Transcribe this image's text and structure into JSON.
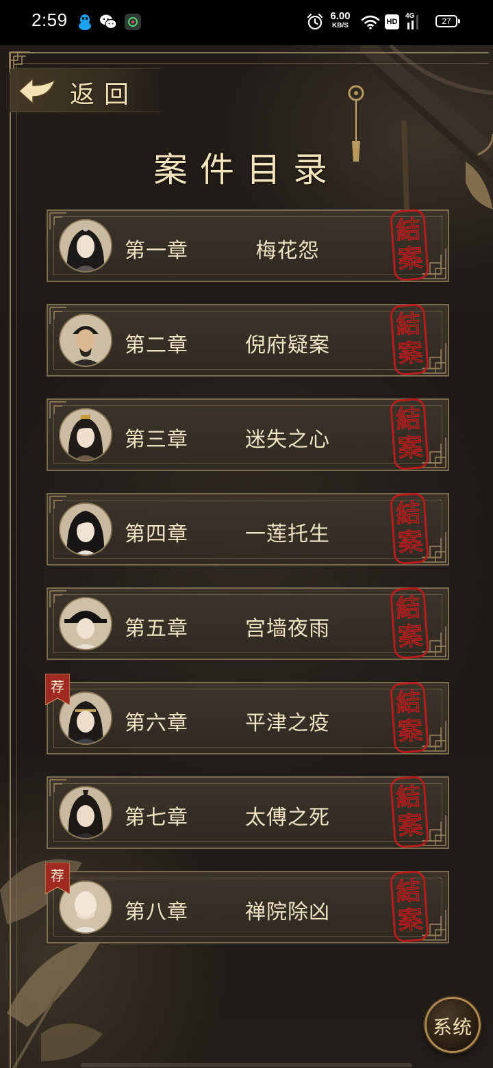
{
  "status_bar": {
    "time": "2:59",
    "net_speed_value": "6.00",
    "net_speed_unit": "KB/S",
    "hd_label": "HD",
    "signal_label": "4G",
    "battery": "27",
    "left_icons": [
      "qq-icon",
      "wechat-icon",
      "app-icon"
    ],
    "right_icons": [
      "alarm-icon",
      "wifi-icon",
      "hd-icon",
      "signal-4g-icon",
      "battery-icon"
    ]
  },
  "back": {
    "label": "返回"
  },
  "title": "案件目录",
  "chapters": [
    {
      "number": "第一章",
      "title": "梅花怨",
      "seal": "結案",
      "recommended": false,
      "avatar": "character-1"
    },
    {
      "number": "第二章",
      "title": "倪府疑案",
      "seal": "結案",
      "recommended": false,
      "avatar": "character-2"
    },
    {
      "number": "第三章",
      "title": "迷失之心",
      "seal": "結案",
      "recommended": false,
      "avatar": "character-3"
    },
    {
      "number": "第四章",
      "title": "一莲托生",
      "seal": "結案",
      "recommended": false,
      "avatar": "character-4"
    },
    {
      "number": "第五章",
      "title": "宫墙夜雨",
      "seal": "結案",
      "recommended": false,
      "avatar": "character-5"
    },
    {
      "number": "第六章",
      "title": "平津之疫",
      "seal": "結案",
      "recommended": true,
      "tag": "荐",
      "avatar": "character-6"
    },
    {
      "number": "第七章",
      "title": "太傅之死",
      "seal": "結案",
      "recommended": false,
      "avatar": "character-7"
    },
    {
      "number": "第八章",
      "title": "禅院除凶",
      "seal": "結案",
      "recommended": true,
      "tag": "荐",
      "avatar": "character-8"
    }
  ],
  "system": {
    "label": "系统"
  },
  "colors": {
    "seal_red": "#b81c1c",
    "text_gold": "#efe3c4",
    "frame_bronze": "#7c6c50",
    "tag_red": "#9e2a22"
  }
}
